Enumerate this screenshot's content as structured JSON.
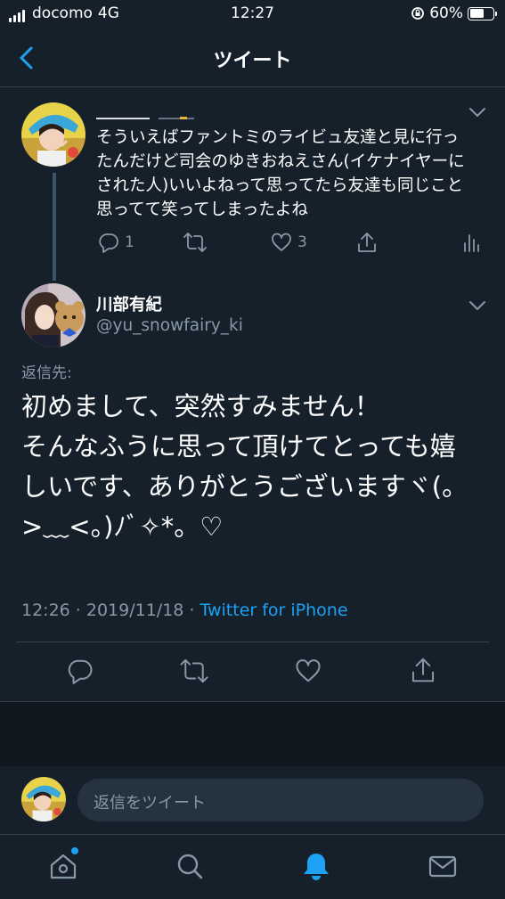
{
  "status_bar": {
    "carrier": "docomo",
    "network": "4G",
    "time": "12:27",
    "battery": "60%",
    "battery_level": 0.6
  },
  "nav": {
    "title": "ツイート"
  },
  "parent_tweet": {
    "text": "そういえばファントミのライビュ友達と見に行ったんだけど司会のゆきおねえさん(イケナイヤーにされた人)いいよねって思ってたら友達も同じこと思ってて笑ってしまったよね",
    "reply_count": "1",
    "like_count": "3"
  },
  "main_tweet": {
    "author_name": "川部有紀",
    "author_handle": "@yu_snowfairy_ki",
    "reply_to_label": "返信先:",
    "lines": [
      "初めまして、突然すみません！",
      "そんなふうに思って頂けてとっても嬉",
      "しいです、ありがとうございますヾ(。",
      ">﹏<。)ﾉﾞ✧*。♡"
    ],
    "timestamp": "12:26 · 2019/11/18 · ",
    "source": "Twitter for iPhone"
  },
  "reply_bar": {
    "placeholder": "返信をツイート"
  },
  "colors": {
    "background": "#15202b",
    "accent": "#1da1f2",
    "muted": "#8899a6",
    "border": "#38444d"
  }
}
